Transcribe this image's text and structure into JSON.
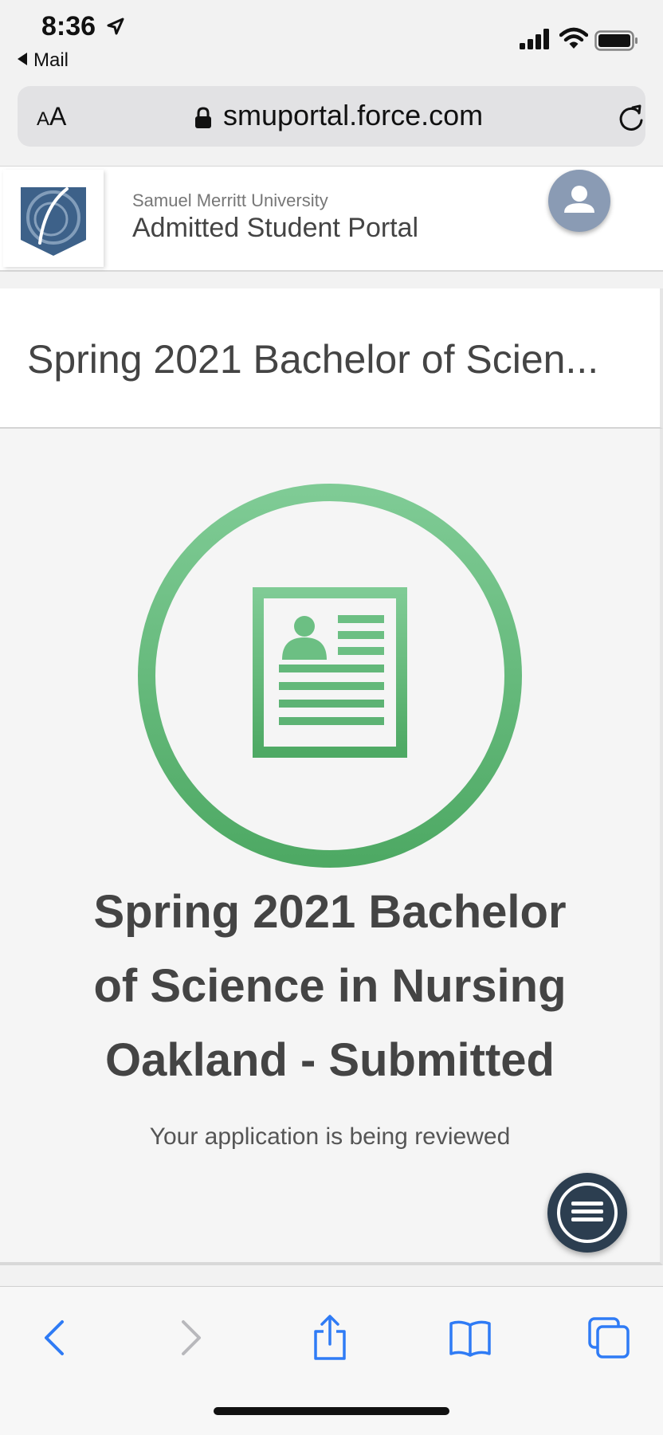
{
  "status_bar": {
    "time": "8:36",
    "back_app": "Mail",
    "icons": [
      "location-arrow-icon",
      "signal-icon",
      "wifi-icon",
      "battery-icon"
    ]
  },
  "address_bar": {
    "text_size_small": "A",
    "text_size_large": "A",
    "url": "smuportal.force.com",
    "icons": [
      "lock-icon",
      "reload-icon"
    ]
  },
  "site_header": {
    "university": "Samuel Merritt University",
    "portal_title": "Admitted Student Portal",
    "icons": [
      "university-logo",
      "user-avatar-icon"
    ]
  },
  "title_card": {
    "title": "Spring 2021 Bachelor of Scien..."
  },
  "status_card": {
    "headline_line1": "Spring 2021 Bachelor",
    "headline_line2": "of Science in Nursing",
    "headline_line3": "Oakland - Submitted",
    "message": "Your application is being reviewed",
    "icon": "application-document-icon",
    "accent_color": "#62b87a"
  },
  "toolbar": {
    "icons": [
      "back-icon",
      "forward-icon",
      "share-icon",
      "bookmarks-icon",
      "tabs-icon"
    ],
    "active_color": "#2f7bf5",
    "disabled_color": "#b8b8bc"
  }
}
